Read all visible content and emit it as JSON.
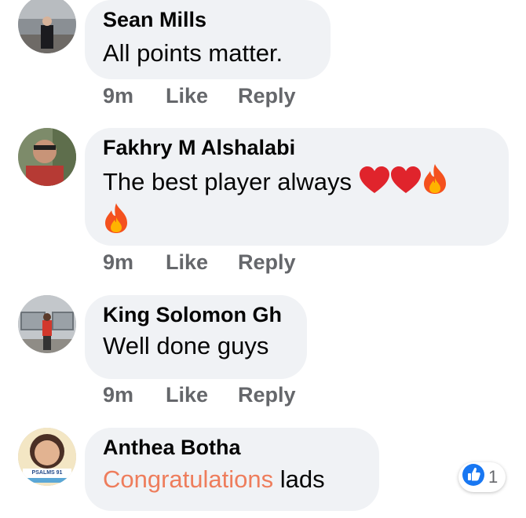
{
  "comments": [
    {
      "author": "Sean Mills",
      "text": "All points matter.",
      "time": "9m",
      "like_label": "Like",
      "reply_label": "Reply"
    },
    {
      "author": "Fakhry M Alshalabi",
      "text": "The best player always",
      "emojis": [
        "red-heart",
        "red-heart",
        "fire",
        "fire"
      ],
      "time": "9m",
      "like_label": "Like",
      "reply_label": "Reply"
    },
    {
      "author": "King Solomon Gh",
      "text": "Well done guys",
      "time": "9m",
      "like_label": "Like",
      "reply_label": "Reply"
    },
    {
      "author": "Anthea Botha",
      "link_text": "Congratulations",
      "text_after": "lads",
      "reaction": {
        "icon": "thumbs-up-icon",
        "count": "1"
      },
      "avatar_caption": "PSALMS 91"
    }
  ],
  "colors": {
    "bubble": "#f0f2f5",
    "name": "#050505",
    "meta": "#65676b",
    "link": "#ee7d5c",
    "like_reaction": "#1877f2"
  }
}
